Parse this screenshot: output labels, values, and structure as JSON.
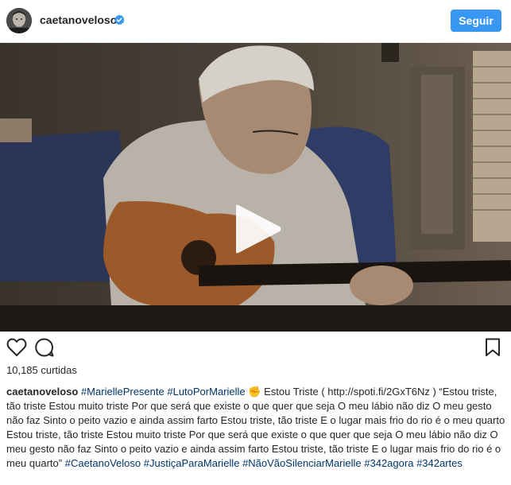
{
  "post": {
    "username": "caetanoveloso",
    "follow_label": "Seguir",
    "likes_text": "10,185 curtidas"
  },
  "icons": {
    "verified": "verified-badge-icon",
    "play": "play-icon",
    "like": "heart-icon",
    "comment": "comment-icon",
    "save": "bookmark-icon"
  },
  "colors": {
    "accent": "#3897f0",
    "hashtag": "#003569"
  },
  "caption": {
    "username": "caetanoveloso",
    "tag1": "#MariellePresente",
    "tag2": "#LutoPorMarielle",
    "emoji": "✊",
    "text1": "Estou Triste ( http://spoti.fi/2GxT6Nz ) “Estou triste, tão triste Estou muito triste Por que será que existe o que quer que seja O meu lábio não diz O meu gesto não faz Sinto o peito vazio e ainda assim farto Estou triste, tão triste E o lugar mais frio do rio é o meu quarto Estou triste, tão triste Estou muito triste Por que será que existe o que quer que seja O meu lábio não diz O meu gesto não faz Sinto o peito vazio e ainda assim farto Estou triste, tão triste E o lugar mais frio do rio é o meu quarto”",
    "tag3": "#CaetanoVeloso",
    "tag4": "#JustiçaParaMarielle",
    "tag5": "#NãoVãoSilenciarMarielle",
    "tag6": "#342agora",
    "tag7": "#342artes"
  }
}
